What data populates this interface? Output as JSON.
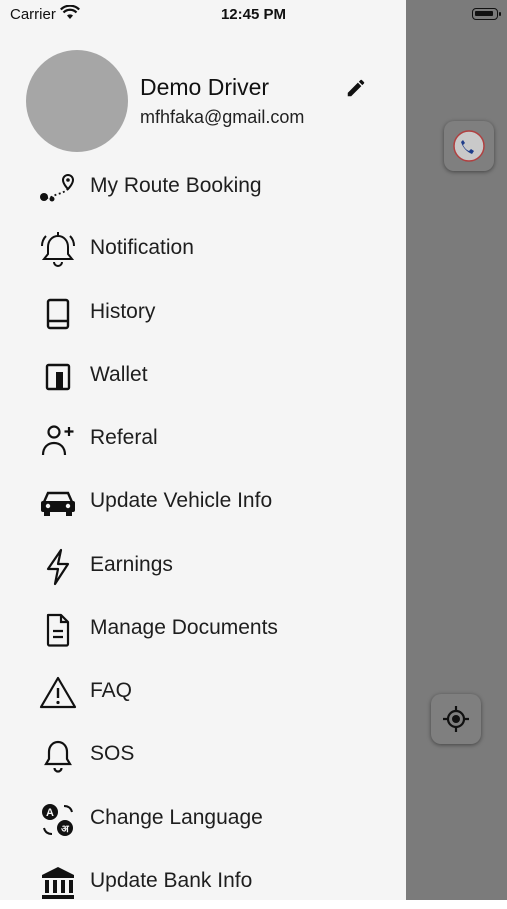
{
  "status_bar": {
    "carrier": "Carrier",
    "time": "12:45 PM"
  },
  "profile": {
    "name": "Demo Driver",
    "email": "mfhfaka@gmail.com"
  },
  "menu": [
    {
      "label": "My Route Booking",
      "icon": "route-icon"
    },
    {
      "label": "Notification",
      "icon": "bell-icon"
    },
    {
      "label": "History",
      "icon": "book-icon"
    },
    {
      "label": "Wallet",
      "icon": "wallet-icon"
    },
    {
      "label": "Referal",
      "icon": "person-add-icon"
    },
    {
      "label": "Update Vehicle Info",
      "icon": "car-icon"
    },
    {
      "label": "Earnings",
      "icon": "lightning-icon"
    },
    {
      "label": "Manage Documents",
      "icon": "document-icon"
    },
    {
      "label": "FAQ",
      "icon": "warning-icon"
    },
    {
      "label": "SOS",
      "icon": "alarm-bell-icon"
    },
    {
      "label": "Change Language",
      "icon": "translate-icon"
    },
    {
      "label": "Update Bank Info",
      "icon": "bank-icon"
    }
  ],
  "floating_buttons": {
    "top": "help-call-icon",
    "bottom": "gps-locate-icon"
  },
  "colors": {
    "drawer_bg": "#f5f5f5",
    "scrim": "#7b7b7b",
    "avatar": "#a6a6a6"
  }
}
